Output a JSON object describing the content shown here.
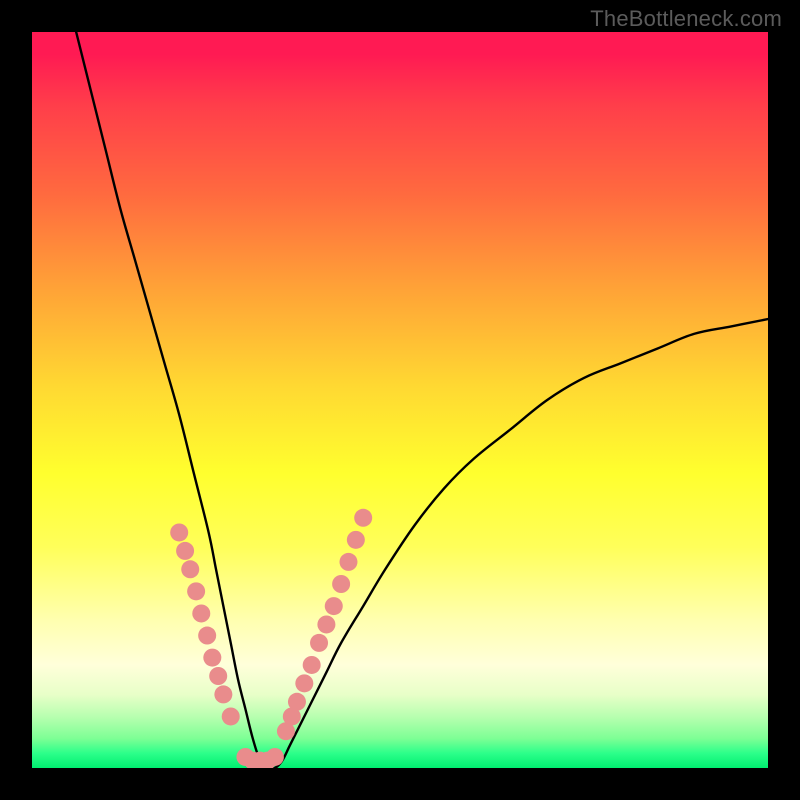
{
  "attribution": "TheBottleneck.com",
  "chart_data": {
    "type": "line",
    "title": "",
    "xlabel": "",
    "ylabel": "",
    "xlim": [
      0,
      100
    ],
    "ylim": [
      0,
      100
    ],
    "gradient_axis": "y",
    "gradient_stops": [
      {
        "pos": 0,
        "color": "#00ee70"
      },
      {
        "pos": 2,
        "color": "#2cff8a"
      },
      {
        "pos": 4,
        "color": "#7dff95"
      },
      {
        "pos": 7,
        "color": "#b8ffb0"
      },
      {
        "pos": 10,
        "color": "#e8ffc8"
      },
      {
        "pos": 14,
        "color": "#ffffda"
      },
      {
        "pos": 20,
        "color": "#ffffb0"
      },
      {
        "pos": 30,
        "color": "#ffff5a"
      },
      {
        "pos": 40,
        "color": "#ffff2e"
      },
      {
        "pos": 52,
        "color": "#ffd832"
      },
      {
        "pos": 65,
        "color": "#ffa337"
      },
      {
        "pos": 78,
        "color": "#ff6a3f"
      },
      {
        "pos": 90,
        "color": "#ff3e4a"
      },
      {
        "pos": 100,
        "color": "#ff1a53"
      }
    ],
    "series": [
      {
        "name": "bottleneck-curve",
        "x": [
          6,
          8,
          10,
          12,
          14,
          16,
          18,
          20,
          22,
          24,
          25,
          26,
          27,
          28,
          29,
          30,
          31,
          32,
          33,
          34,
          35,
          36,
          38,
          40,
          42,
          45,
          48,
          52,
          56,
          60,
          65,
          70,
          75,
          80,
          85,
          90,
          95,
          100
        ],
        "y": [
          100,
          92,
          84,
          76,
          69,
          62,
          55,
          48,
          40,
          32,
          27,
          22,
          17,
          12,
          8,
          4,
          1,
          0,
          0,
          1,
          3,
          5,
          9,
          13,
          17,
          22,
          27,
          33,
          38,
          42,
          46,
          50,
          53,
          55,
          57,
          59,
          60,
          61
        ]
      }
    ],
    "marker_clusters": [
      {
        "name": "left-band",
        "points": [
          {
            "x": 20.0,
            "y": 32.0
          },
          {
            "x": 20.8,
            "y": 29.5
          },
          {
            "x": 21.5,
            "y": 27.0
          },
          {
            "x": 22.3,
            "y": 24.0
          },
          {
            "x": 23.0,
            "y": 21.0
          },
          {
            "x": 23.8,
            "y": 18.0
          },
          {
            "x": 24.5,
            "y": 15.0
          },
          {
            "x": 25.3,
            "y": 12.5
          },
          {
            "x": 26.0,
            "y": 10.0
          },
          {
            "x": 27.0,
            "y": 7.0
          }
        ]
      },
      {
        "name": "right-band",
        "points": [
          {
            "x": 34.5,
            "y": 5.0
          },
          {
            "x": 35.3,
            "y": 7.0
          },
          {
            "x": 36.0,
            "y": 9.0
          },
          {
            "x": 37.0,
            "y": 11.5
          },
          {
            "x": 38.0,
            "y": 14.0
          },
          {
            "x": 39.0,
            "y": 17.0
          },
          {
            "x": 40.0,
            "y": 19.5
          },
          {
            "x": 41.0,
            "y": 22.0
          },
          {
            "x": 42.0,
            "y": 25.0
          },
          {
            "x": 43.0,
            "y": 28.0
          },
          {
            "x": 44.0,
            "y": 31.0
          },
          {
            "x": 45.0,
            "y": 34.0
          }
        ]
      },
      {
        "name": "bottom-flat",
        "points": [
          {
            "x": 29.0,
            "y": 1.5
          },
          {
            "x": 30.0,
            "y": 1.0
          },
          {
            "x": 31.0,
            "y": 1.0
          },
          {
            "x": 32.0,
            "y": 1.0
          },
          {
            "x": 33.0,
            "y": 1.5
          }
        ]
      }
    ],
    "marker_style": {
      "color": "#e98c8c",
      "radius_px": 9
    }
  }
}
